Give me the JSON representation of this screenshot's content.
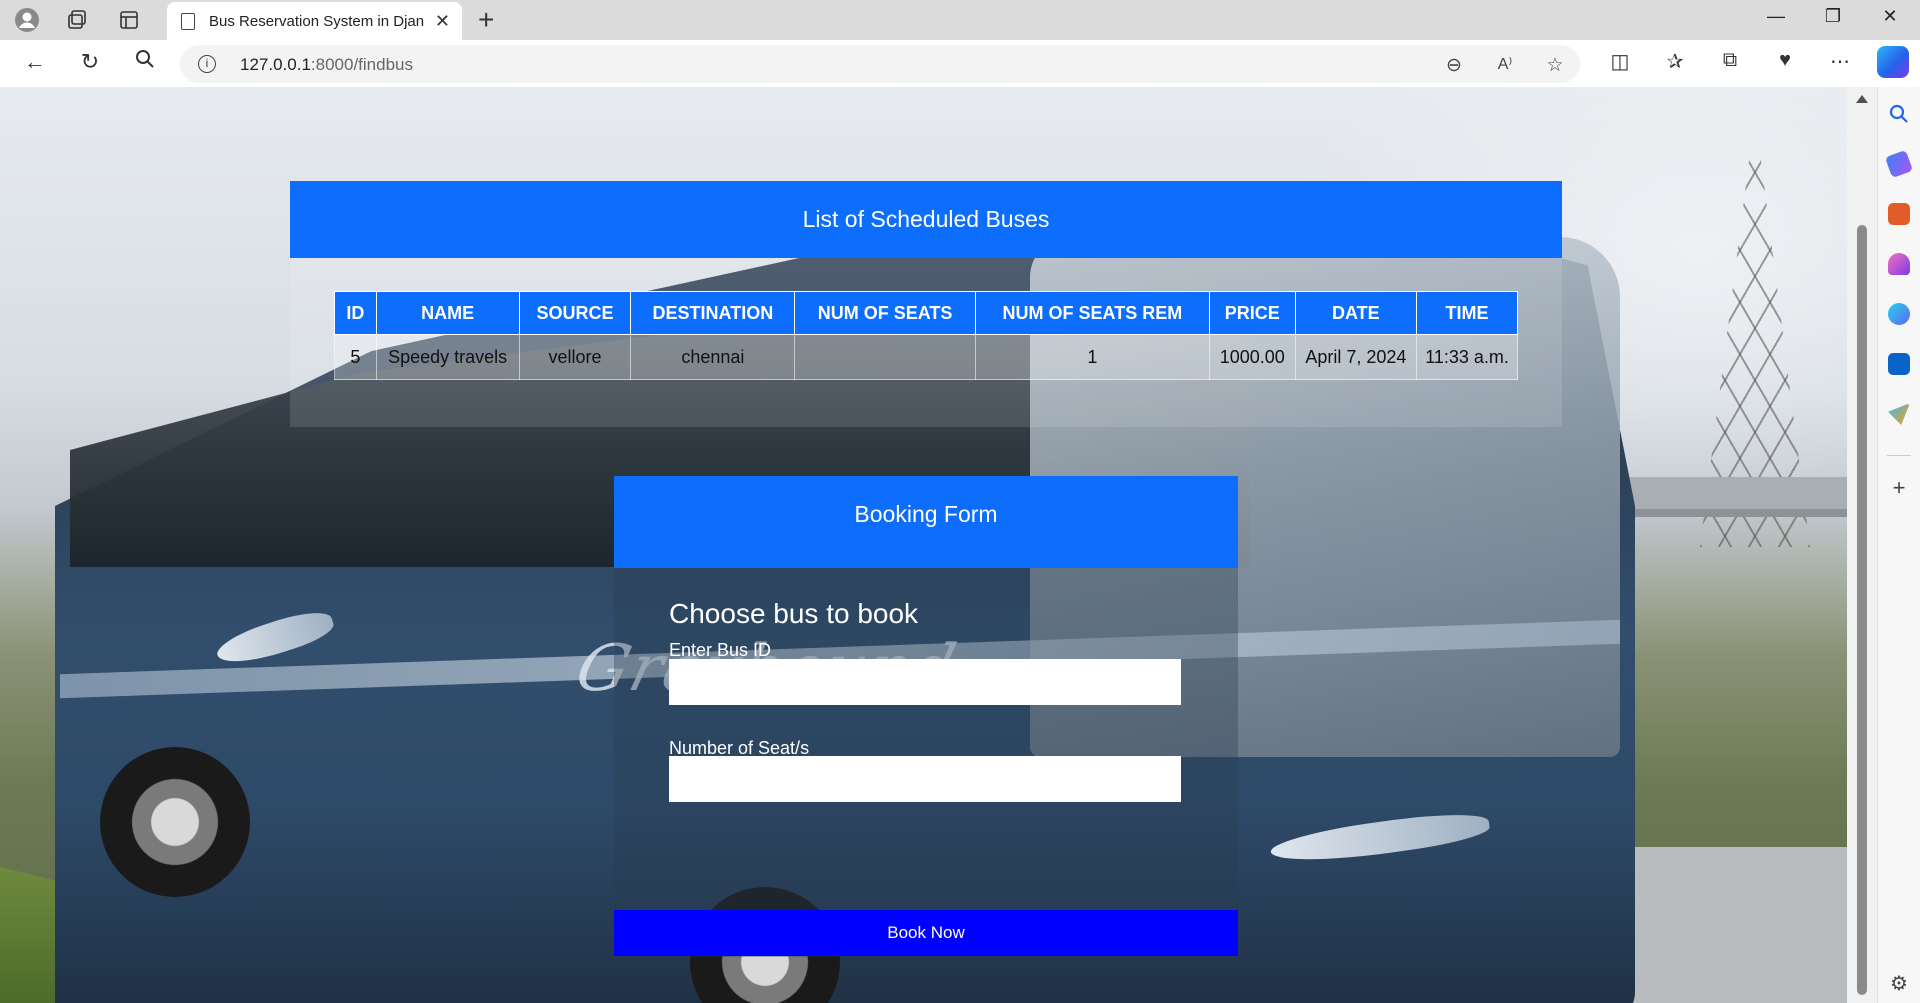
{
  "browser": {
    "tab_title": "Bus Reservation System in Django",
    "url_host": "127.0.0.1",
    "url_path": ":8000/findbus"
  },
  "schedule": {
    "heading": "List of Scheduled Buses",
    "columns": [
      "ID",
      "NAME",
      "SOURCE",
      "DESTINATION",
      "NUM OF SEATS",
      "NUM OF SEATS REM",
      "PRICE",
      "DATE",
      "TIME"
    ],
    "rows": [
      [
        "5",
        "Speedy travels",
        "vellore",
        "chennai",
        "",
        "1",
        "1000.00",
        "April 7, 2024",
        "11:33 a.m."
      ]
    ]
  },
  "booking": {
    "heading": "Booking Form",
    "subtitle": "Choose bus to book",
    "bus_id_label": "Enter Bus ID",
    "seats_label": "Number of Seat/s",
    "submit_label": "Book Now"
  },
  "background": {
    "brand_text": "Greyhound"
  },
  "colors": {
    "header_blue": "#0d6efd",
    "button_blue": "#0000ff"
  }
}
